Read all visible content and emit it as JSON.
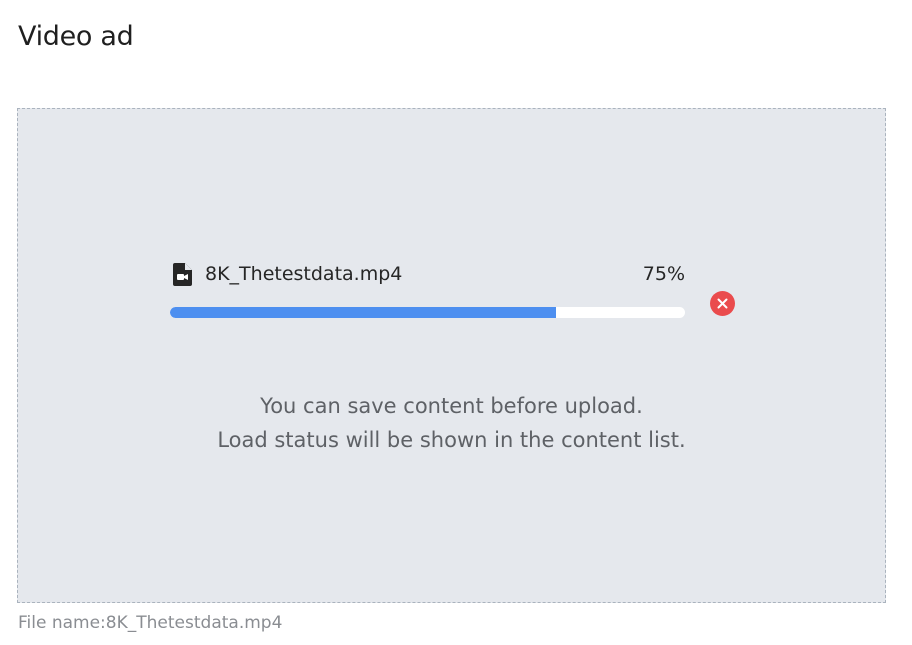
{
  "section": {
    "title": "Video ad"
  },
  "upload": {
    "file_name": "8K_Thetestdata.mp4",
    "percent_label": "75%",
    "progress_fraction": 0.75,
    "file_icon": "video-file-icon",
    "cancel_icon": "close-circle-icon"
  },
  "info": {
    "line1": "You can save content before upload.",
    "line2": "Load status will be shown in the content list."
  },
  "caption": {
    "label": "File name:",
    "value": "8K_Thetestdata.mp4"
  },
  "colors": {
    "progress_fill": "#4d8ff0",
    "progress_track": "#ffffff",
    "cancel": "#ea4b4d",
    "dropzone_bg": "#e5e8ed"
  }
}
